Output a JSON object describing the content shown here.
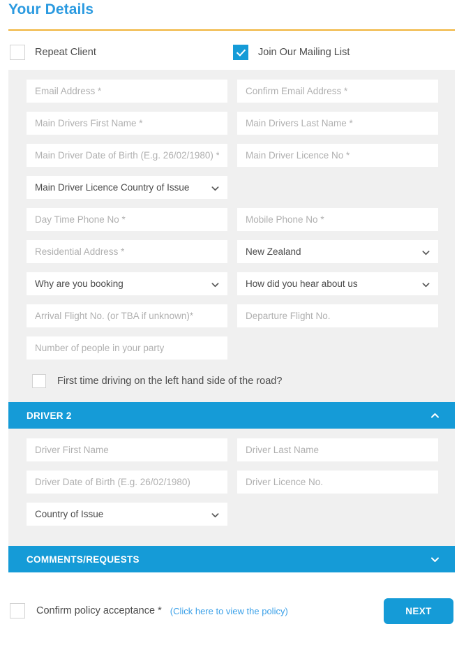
{
  "header": {
    "title": "Your Details"
  },
  "top_checks": [
    {
      "label": "Repeat Client",
      "checked": false,
      "name": "repeat-client"
    },
    {
      "label": "Join Our Mailing List",
      "checked": true,
      "name": "mailing-list"
    }
  ],
  "main_form": {
    "rows": [
      [
        {
          "type": "text",
          "placeholder": "Email Address *"
        },
        {
          "type": "text",
          "placeholder": "Confirm Email Address *"
        }
      ],
      [
        {
          "type": "text",
          "placeholder": "Main Drivers First Name *"
        },
        {
          "type": "text",
          "placeholder": "Main Drivers Last Name *"
        }
      ],
      [
        {
          "type": "text",
          "placeholder": "Main Driver Date of Birth (E.g. 26/02/1980) *"
        },
        {
          "type": "text",
          "placeholder": "Main Driver Licence No *"
        }
      ],
      [
        {
          "type": "select",
          "value": "Main Driver Licence Country of Issue"
        },
        {
          "type": "empty"
        }
      ],
      [
        {
          "type": "text",
          "placeholder": "Day Time Phone No *"
        },
        {
          "type": "text",
          "placeholder": "Mobile Phone No *"
        }
      ],
      [
        {
          "type": "text",
          "placeholder": "Residential Address *"
        },
        {
          "type": "select",
          "value": "New Zealand"
        }
      ],
      [
        {
          "type": "select",
          "value": "Why are you booking"
        },
        {
          "type": "select",
          "value": "How did you hear about us"
        }
      ],
      [
        {
          "type": "text",
          "placeholder": "Arrival Flight No. (or TBA if unknown)*"
        },
        {
          "type": "text",
          "placeholder": "Departure Flight No."
        }
      ],
      [
        {
          "type": "text",
          "placeholder": "Number of people in your party"
        },
        {
          "type": "empty"
        }
      ]
    ],
    "left_side_check": {
      "label": "First time driving on the left hand side of the road?",
      "checked": false
    }
  },
  "driver2": {
    "title": "DRIVER 2",
    "caret": "chevron-up",
    "expanded": true,
    "rows": [
      [
        {
          "type": "text",
          "placeholder": "Driver First Name"
        },
        {
          "type": "text",
          "placeholder": "Driver Last Name"
        }
      ],
      [
        {
          "type": "text",
          "placeholder": "Driver Date of Birth (E.g. 26/02/1980)"
        },
        {
          "type": "text",
          "placeholder": "Driver Licence No."
        }
      ],
      [
        {
          "type": "select",
          "value": "Country of Issue"
        },
        {
          "type": "empty"
        }
      ]
    ]
  },
  "comments": {
    "title": "COMMENTS/REQUESTS",
    "caret": "chevron-down",
    "expanded": false
  },
  "footer": {
    "policy_label": "Confirm policy acceptance *",
    "policy_link": "(Click here to view the policy)",
    "policy_checked": false,
    "next_label": "NEXT"
  },
  "colors": {
    "brand_blue": "#159bd7",
    "title_blue": "#2b9ae0",
    "rule_gold": "#f0b43a",
    "panel_gray": "#f0f0f0",
    "link_blue": "#3aa0e8"
  }
}
